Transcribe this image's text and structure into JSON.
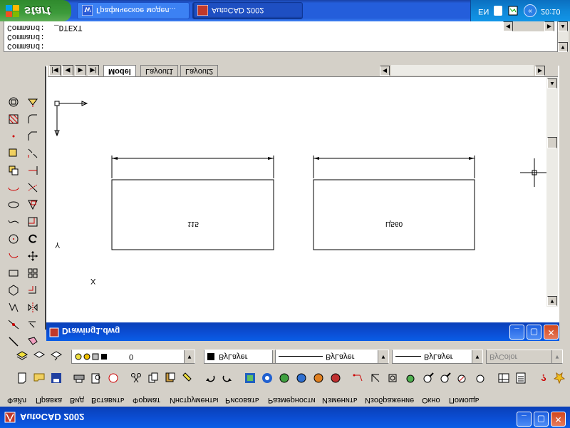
{
  "main_window": {
    "title": "AutoCAD 2002"
  },
  "menu": {
    "items": [
      "Файл",
      "Правка",
      "Вид",
      "Вставить",
      "Формат",
      "Инструменты",
      "Рисовать",
      "Размерности",
      "Изменить",
      "Изображение",
      "Окно",
      "Помощь"
    ]
  },
  "properties": {
    "layer": "0",
    "color": "ByLayer",
    "linetype": "ByLayer",
    "lineweight": "ByLayer",
    "plotstyle": "ByColor"
  },
  "drawing_window": {
    "title": "Drawing1.dwg"
  },
  "tabs": [
    "Model",
    "Layout1",
    "Layout2"
  ],
  "active_tab": "Model",
  "canvas": {
    "ucs_x_label": "X",
    "ucs_y_label": "Y",
    "dimension_left": "115",
    "dimension_right": "Ц560"
  },
  "command": {
    "lines": [
      "Command:  _DTEXT",
      "Command:",
      "Command:"
    ]
  },
  "taskbar": {
    "start_label": "start",
    "tasks": [
      {
        "label": "Графическое модел..."
      },
      {
        "label": "AutoCAD 2002"
      }
    ],
    "language": "EN",
    "clock": "20:10"
  },
  "colors": {
    "title_blue": "#0b4fd6",
    "taskbar_blue": "#245edb",
    "start_green": "#3c9a3a",
    "close_red": "#d2461b"
  }
}
